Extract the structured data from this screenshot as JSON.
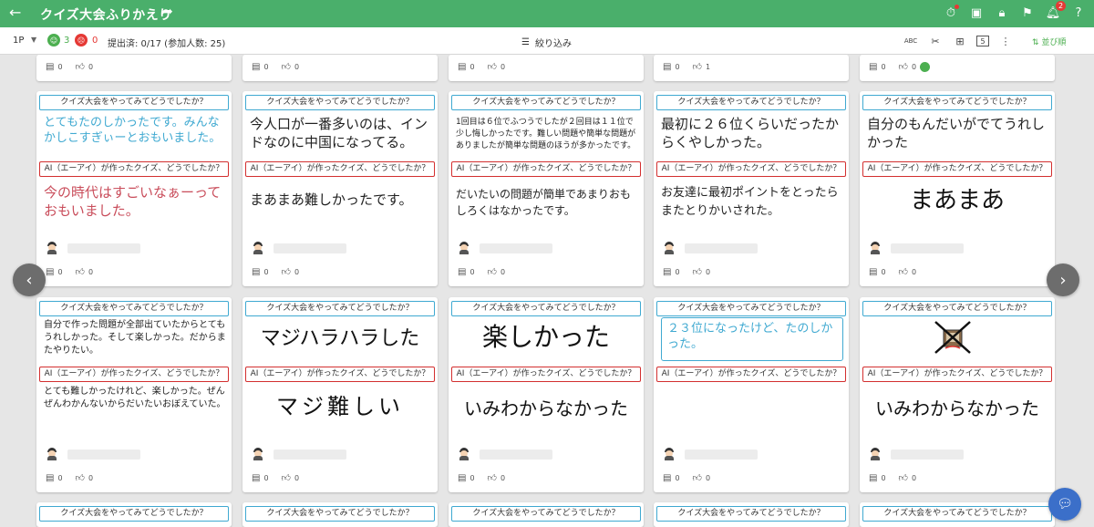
{
  "header": {
    "back_icon": "arrow-left-icon",
    "title": "クイズ大会ふりかえり",
    "share_icon": "share-arrow-icon",
    "icons": [
      "timer-icon",
      "card-view-icon",
      "lock-icon",
      "class-icon",
      "bell-icon",
      "help-icon"
    ],
    "notification_count": "2",
    "bar_color": "#4aaf6b"
  },
  "toolbar": {
    "page": "1P",
    "good_count": "3",
    "bad_count": "0",
    "status": "提出済: 0/17 (参加人数: 25)",
    "filter_label": "絞り込み",
    "sort_label": "並び順",
    "page_box": "5",
    "abc_label": "ABC"
  },
  "labels": {
    "question": "クイズ大会をやってみてどうでしたか？",
    "ai_question": "AI（エーアイ）が作ったクイズ、どうでしたか？"
  },
  "top_row_counts": [
    {
      "comments": "0",
      "likes": "0"
    },
    {
      "comments": "0",
      "likes": "0"
    },
    {
      "comments": "0",
      "likes": "0"
    },
    {
      "comments": "0",
      "likes": "1"
    },
    {
      "comments": "0",
      "likes": "0"
    }
  ],
  "row1": [
    {
      "q": "とてもたのしかったです。みんなかしこすぎぃーとおもいました。",
      "a": "今の時代はすごいなぁーっておもいました。",
      "comments": "0",
      "likes": "0"
    },
    {
      "q": "今人口が一番多いのは、インドなのに中国になってる。",
      "a": "まあまあ難しかったです。",
      "comments": "0",
      "likes": "0"
    },
    {
      "q": "1回目は６位でふつうでしたが２回目は１１位で少し悔しかったです。難しい問題や簡単な問題がありましたが簡単な問題のほうが多かったです。",
      "a": "だいたいの問題が簡単であまりおもしろくはなかったです。",
      "comments": "0",
      "likes": "0"
    },
    {
      "q": "最初に２６位くらいだったからくやしかった。",
      "a": "お友達に最初ポイントをとったらまたとりかいされた。",
      "comments": "0",
      "likes": "0"
    },
    {
      "q": "自分のもんだいがでてうれしかった",
      "a": "まあまあ",
      "comments": "0",
      "likes": "0"
    }
  ],
  "row2": [
    {
      "q": "自分で作った問題が全部出ていたからとてもうれしかった。そして楽しかった。だからまたやりたい。",
      "a": "とても難しかったけれど、楽しかった。ぜんぜんわかんないからだいたいおぼえていた。",
      "comments": "0",
      "likes": "0"
    },
    {
      "q": "マジハラハラした",
      "a": "マジ難しい",
      "comments": "0",
      "likes": "0"
    },
    {
      "q": "楽しかった",
      "a": "いみわからなかった",
      "comments": "0",
      "likes": "0"
    },
    {
      "q": "２３位になったけど、たのしかった。",
      "a": "",
      "comments": "0",
      "likes": "0"
    },
    {
      "q": "",
      "a": "いみわからなかった",
      "comments": "0",
      "likes": "0"
    }
  ],
  "nav": {
    "prev_icon": "chevron-left-icon",
    "next_icon": "chevron-right-icon",
    "chat_icon": "chat-icon"
  }
}
